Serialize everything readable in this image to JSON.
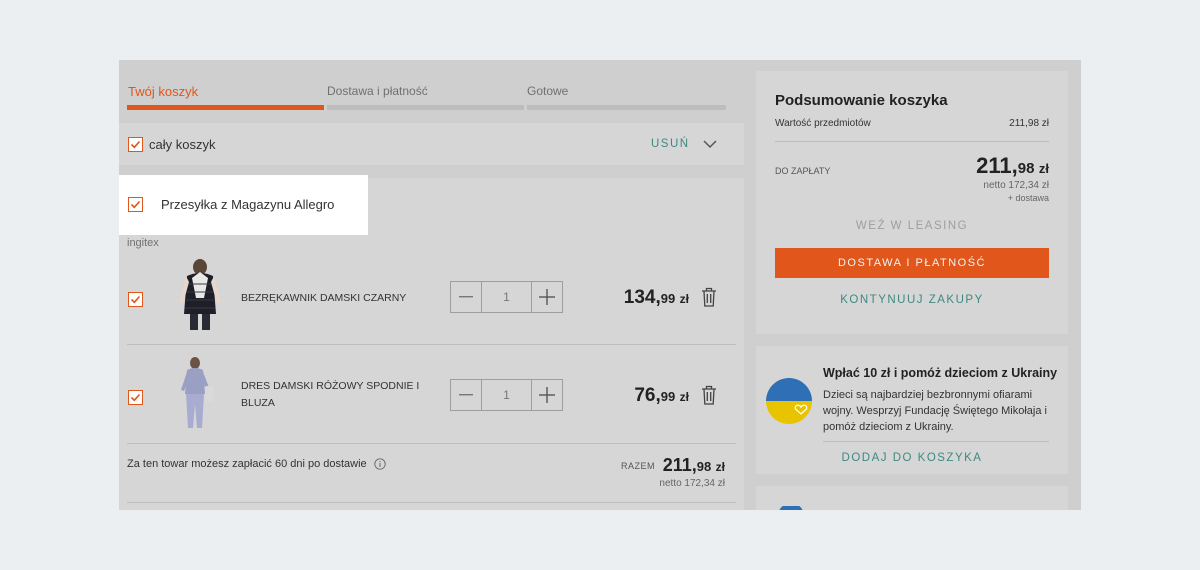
{
  "steps": [
    {
      "label": "Twój koszyk",
      "active": true
    },
    {
      "label": "Dostawa i płatność",
      "active": false
    },
    {
      "label": "Gotowe",
      "active": false
    }
  ],
  "cart_header": {
    "select_all_label": "cały koszyk",
    "remove_label": "USUŃ"
  },
  "shipment": {
    "label": "Przesyłka z Magazynu Allegro",
    "seller": "ingitex"
  },
  "items": [
    {
      "name": "BEZRĘKAWNIK DAMSKI CZARNY",
      "quantity": "1",
      "price_int": "134,",
      "price_dec": "99",
      "currency": "zł"
    },
    {
      "name_line1": "DRES DAMSKI RÓŻOWY SPODNIE I",
      "name_line2": "BLUZA",
      "quantity": "1",
      "price_int": "76,",
      "price_dec": "99",
      "currency": "zł"
    }
  ],
  "pay_later": {
    "text": "Za ten towar możesz zapłacić 60 dni po dostawie"
  },
  "group_total": {
    "label": "RAZEM",
    "int": "211,",
    "dec": "98",
    "currency": "zł",
    "net": "netto 172,34 zł"
  },
  "summary": {
    "title": "Podsumowanie koszyka",
    "items_value_label": "Wartość przedmiotów",
    "items_value": "211,98 zł",
    "to_pay_label": "DO ZAPŁATY",
    "total_int": "211,",
    "total_dec": "98",
    "currency": "zł",
    "net": "netto 172,34 zł",
    "plus_delivery": "+ dostawa",
    "leasing_label": "WEŹ W LEASING",
    "checkout_label": "DOSTAWA I PŁATNOŚĆ",
    "continue_label": "KONTYNUUJ ZAKUPY"
  },
  "charity": {
    "title": "Wpłać 10 zł i pomóż dzieciom z Ukrainy",
    "line1": "Dzieci są najbardziej bezbronnymi ofiarami",
    "line2": "wojny. Wesprzyj Fundację Świętego Mikołaja i",
    "line3": "pomóż dzieciom z Ukrainy.",
    "add_label": "DODAJ DO KOSZYKA"
  },
  "colors": {
    "accent": "#e0561b",
    "link": "#3d8a80",
    "ukraine_blue": "#2f6fb5",
    "ukraine_yellow": "#e8c400"
  }
}
